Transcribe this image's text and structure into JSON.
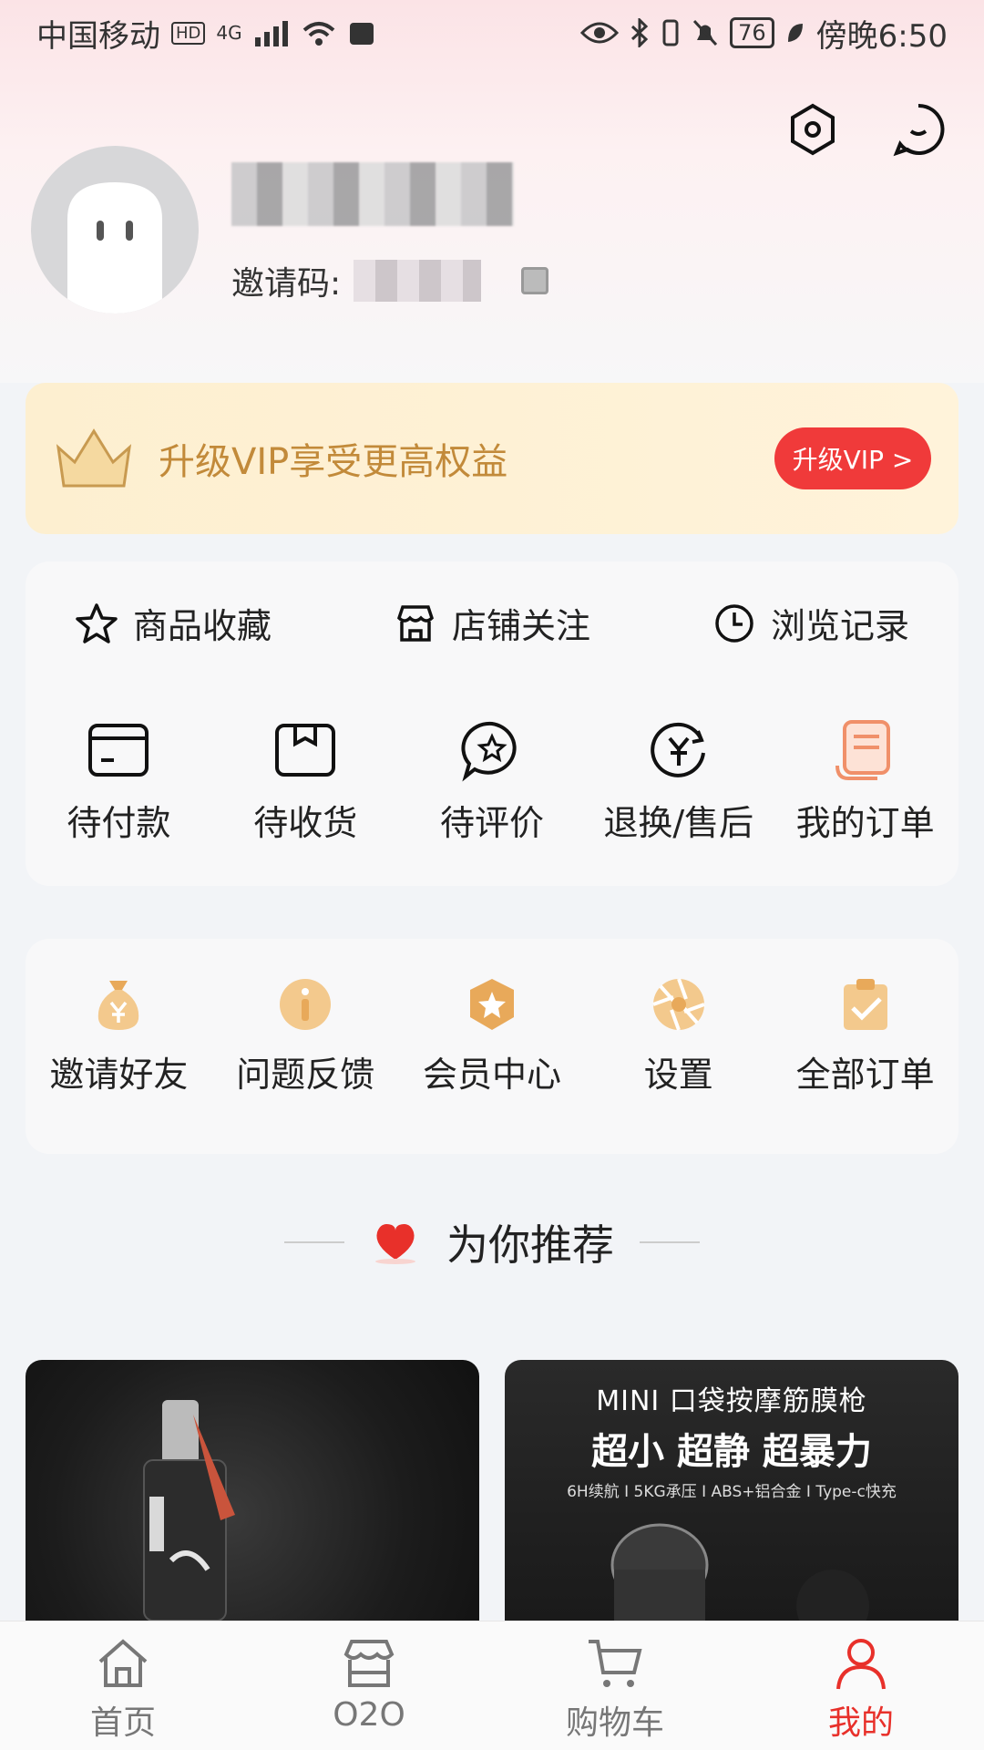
{
  "status_bar": {
    "carrier": "中国移动",
    "hd": "HD",
    "network": "4G",
    "battery": "76",
    "time": "傍晚6:50"
  },
  "profile": {
    "invite_label": "邀请码:"
  },
  "vip_banner": {
    "text": "升级VIP享受更高权益",
    "button": "升级VIP >"
  },
  "quick_links": [
    {
      "label": "商品收藏",
      "icon": "star-icon"
    },
    {
      "label": "店铺关注",
      "icon": "store-icon"
    },
    {
      "label": "浏览记录",
      "icon": "clock-icon"
    }
  ],
  "orders": [
    {
      "label": "待付款",
      "icon": "card-icon"
    },
    {
      "label": "待收货",
      "icon": "package-icon"
    },
    {
      "label": "待评价",
      "icon": "review-icon"
    },
    {
      "label": "退换/售后",
      "icon": "refund-icon"
    },
    {
      "label": "我的订单",
      "icon": "order-list-icon"
    }
  ],
  "services": [
    {
      "label": "邀请好友",
      "icon": "money-bag-icon"
    },
    {
      "label": "问题反馈",
      "icon": "info-icon"
    },
    {
      "label": "会员中心",
      "icon": "member-star-icon"
    },
    {
      "label": "设置",
      "icon": "aperture-icon"
    },
    {
      "label": "全部订单",
      "icon": "clipboard-check-icon"
    }
  ],
  "recommend": {
    "title": "为你推荐"
  },
  "products": [
    {
      "name": "liquor-bottle"
    },
    {
      "line1": "MINI 口袋按摩筋膜枪",
      "line2": "超小 超静 超暴力",
      "line3": "6H续航 I 5KG承压 I ABS+铝合金 I Type-c快充"
    }
  ],
  "tabbar": [
    {
      "label": "首页",
      "icon": "home-icon"
    },
    {
      "label": "O2O",
      "icon": "shop-icon"
    },
    {
      "label": "购物车",
      "icon": "cart-icon"
    },
    {
      "label": "我的",
      "icon": "user-icon",
      "active": true
    }
  ],
  "colors": {
    "accent": "#e8302a",
    "vip_text": "#c28a3a",
    "vip_button": "#f03a3a",
    "gold_icon": "#e8a95a"
  }
}
